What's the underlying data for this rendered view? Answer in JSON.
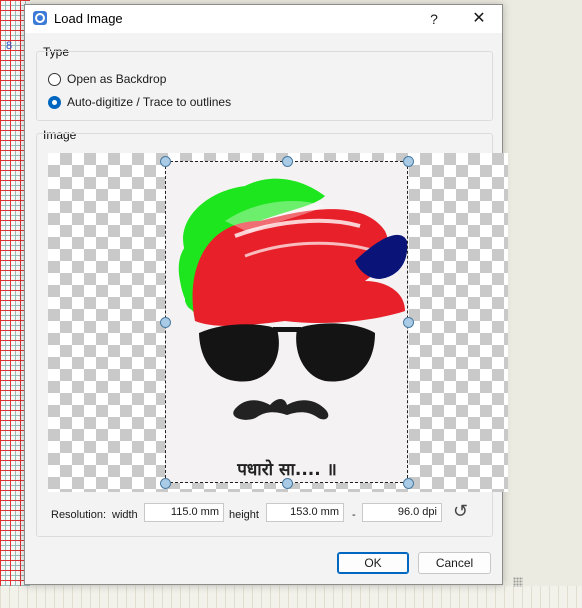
{
  "background": {
    "ruler_label": "8"
  },
  "dialog": {
    "title": "Load Image",
    "help_label": "?",
    "close_label": "✕"
  },
  "type_group": {
    "label": "Type",
    "options": [
      {
        "label": "Open as Backdrop",
        "selected": false
      },
      {
        "label": "Auto-digitize / Trace to outlines",
        "selected": true
      }
    ]
  },
  "image_group": {
    "label": "Image",
    "preview_caption": "पधारो सा.... ॥"
  },
  "resolution": {
    "label": "Resolution:",
    "width_label": "width",
    "width_value": "115.0 mm",
    "height_label": "height",
    "height_value": "153.0 mm",
    "separator": "-",
    "dpi_value": "96.0 dpi"
  },
  "buttons": {
    "ok": "OK",
    "cancel": "Cancel"
  },
  "colors": {
    "accent": "#0067c0",
    "turban_green": "#1ee61e",
    "turban_red": "#e8202a",
    "turban_blue": "#0a1478",
    "glasses": "#141414"
  }
}
